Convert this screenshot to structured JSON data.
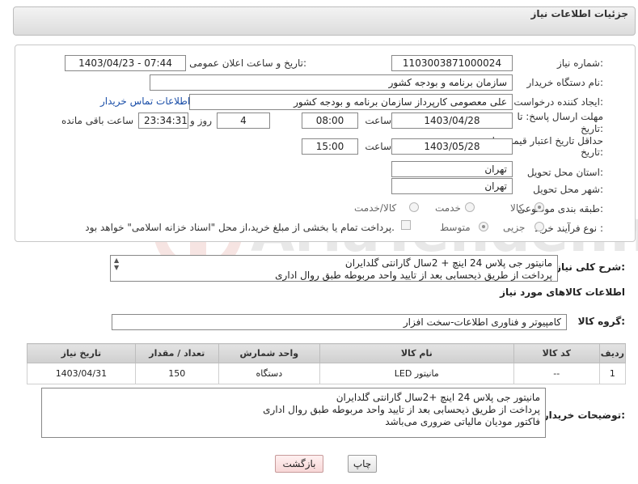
{
  "header": {
    "title": "جزئیات اطلاعات نیاز"
  },
  "form": {
    "need_number_label": "شماره نیاز:",
    "need_number": "1103003871000024",
    "announce_label": "تاریخ و ساعت اعلان عمومی:",
    "announce_value": "1403/04/23 - 07:44",
    "buyer_org_label": "نام دستگاه خریدار:",
    "buyer_org": "سازمان برنامه و بودجه کشور",
    "creator_label": "ایجاد کننده درخواست:",
    "creator": "علی معصومی کارپرداز سازمان برنامه و بودجه کشور",
    "contact_link": "اطلاعات تماس خریدار",
    "deadline_label_1": "مهلت ارسال پاسخ: تا",
    "deadline_label_2": "تاریخ:",
    "deadline_date": "1403/04/28",
    "time_label": "ساعت",
    "deadline_time": "08:00",
    "days_value": "4",
    "days_label": "روز و",
    "remaining_value": "23:34:31",
    "remaining_label": "ساعت باقی مانده",
    "validity_label_1": "حداقل تاریخ اعتبار قیمت: تا",
    "validity_label_2": "تاریخ:",
    "validity_date": "1403/05/28",
    "validity_time": "15:00",
    "province_label": "استان محل تحویل:",
    "province": "تهران",
    "city_label": "شهر محل تحویل:",
    "city": "تهران",
    "category_label": "طبقه بندی موضوعی:",
    "category_options": [
      "کالا",
      "خدمت",
      "کالا/خدمت"
    ],
    "process_label": "نوع فرآیند خرید :",
    "process_options": [
      "جزیی",
      "متوسط"
    ],
    "payment_note": "پرداخت تمام یا بخشی از مبلغ خرید،از محل \"اسناد خزانه اسلامی\" خواهد بود."
  },
  "description": {
    "label": "شرح کلی نیاز:",
    "lines": [
      "مانیتور جی پلاس 24 اینچ + 2سال گارانتی گلدایران",
      "پرداخت از طریق ذیحسابی بعد از تایید واحد مربوطه طبق روال اداری"
    ]
  },
  "goods_section": {
    "title": "اطلاعات کالاهای مورد نیاز",
    "group_label": "گروه کالا:",
    "group_value": "کامپیوتر و فناوری اطلاعات-سخت افزار"
  },
  "table": {
    "headers": [
      "ردیف",
      "کد کالا",
      "نام کالا",
      "واحد شمارش",
      "تعداد / مقدار",
      "تاریخ نیاز"
    ],
    "rows": [
      [
        "1",
        "--",
        "مانیتور LED",
        "دستگاه",
        "150",
        "1403/04/31"
      ]
    ]
  },
  "buyer_notes": {
    "label": "توضیحات خریدار:",
    "lines": [
      "مانیتور جی پلاس 24 اینچ +2سال گارانتی گلدایران",
      "پرداخت از طریق ذیحسابی بعد از تایید واحد مربوطه طبق روال اداری",
      "فاکتور مودیان مالیاتی ضروری می‌باشد"
    ]
  },
  "buttons": {
    "print": "چاپ",
    "back": "بازگشت"
  },
  "colors": {
    "link": "#1a4ea8",
    "back_button": "#f7d7d7"
  }
}
